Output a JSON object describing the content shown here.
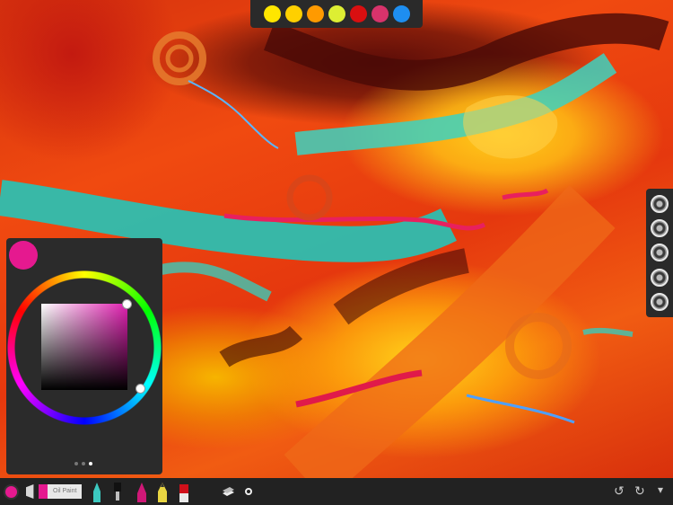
{
  "colors": {
    "current": "#e5198f",
    "palette": [
      "#ffe600",
      "#ffd000",
      "#ff9a00",
      "#ddee33",
      "#d90f10",
      "#d8336b",
      "#1e8ef0"
    ]
  },
  "palette_icons": [
    "yellow-swatch",
    "gold-swatch",
    "orange-swatch",
    "lime-swatch",
    "red-swatch",
    "rose-swatch",
    "blue-swatch"
  ],
  "brushes": [
    "brush-1-icon",
    "brush-2-icon",
    "brush-3-icon",
    "brush-4-icon",
    "brush-5-icon"
  ],
  "toolbar": {
    "brush_label": "Oil Paint",
    "tools": [
      "marker-tool",
      "dropper-tool",
      "ink-tool",
      "pencil-tool",
      "eraser-tool"
    ],
    "undo_glyph": "↺",
    "redo_glyph": "↻",
    "more_glyph": "▾"
  },
  "picker": {
    "page_dots": 3,
    "active_dot": 3
  }
}
